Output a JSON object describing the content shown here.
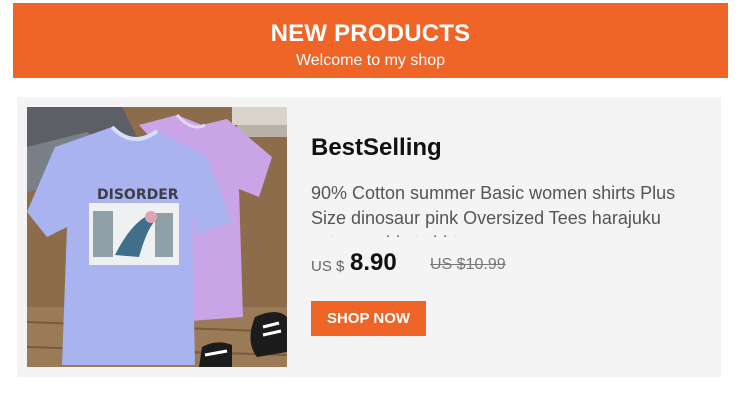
{
  "banner": {
    "title": "NEW PRODUCTS",
    "subtitle": "Welcome to my shop"
  },
  "product": {
    "heading": "BestSelling",
    "description": "90% Cotton summer Basic women shirts Plus Size dinosaur pink Oversized Tees harajuku cute graphic t shirts",
    "currency": "US $",
    "price": "8.90",
    "original_price": "US $10.99",
    "button_label": "SHOP NOW",
    "image_print_text": "DISORDER"
  },
  "colors": {
    "accent": "#EF6427",
    "card_background": "#F4F4F4"
  }
}
